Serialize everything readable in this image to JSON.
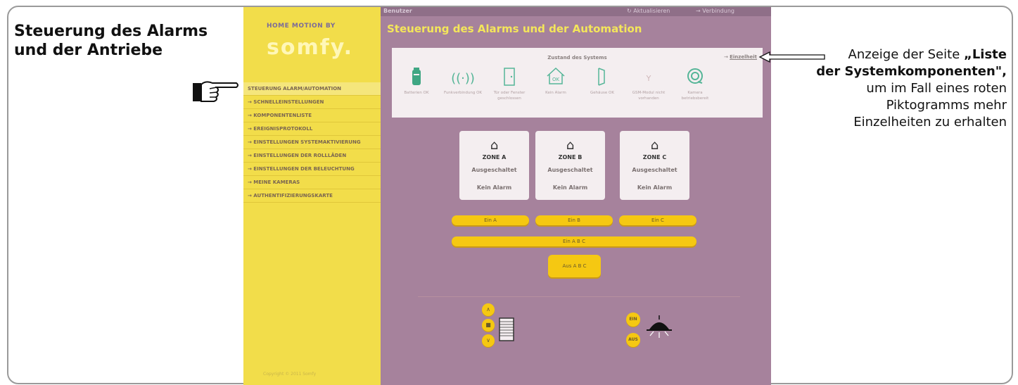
{
  "doc": {
    "title_line1": "Steuerung des Alarms",
    "title_line2": "und der Antriebe",
    "callout_line1": "Anzeige der Seite ",
    "callout_bold1": "„Liste",
    "callout_bold2": "der Systemkomponenten\",",
    "callout_line3": "um im Fall eines roten",
    "callout_line4": "Piktogramms mehr",
    "callout_line5": "Einzelheiten zu erhalten"
  },
  "app": {
    "topbar": {
      "user": "Benutzer",
      "refresh": "↻ Aktualisieren",
      "connection": "→ Verbindung"
    },
    "logo_small": "HOME MOTION BY",
    "logo_big": "somfy.",
    "menu": [
      "STEUERUNG ALARM/AUTOMATION",
      "→ SCHNELLEINSTELLUNGEN",
      "→ KOMPONENTENLISTE",
      "→ EREIGNISPROTOKOLL",
      "→ EINSTELLUNGEN SYSTEMAKTIVIERUNG",
      "→ EINSTELLUNGEN DER ROLLLÄDEN",
      "→ EINSTELLUNGEN DER BELEUCHTUNG",
      "→ MEINE KAMERAS",
      "→ AUTHENTIFIZIERUNGSKARTE"
    ],
    "copyright": "Copyright © 2011 Somfy",
    "page_title": "Steuerung des Alarms und der Automation",
    "status": {
      "title": "Zustand des Systems",
      "detail_arrow": "→",
      "detail_link": "Einzelheit",
      "items": [
        {
          "icon": "battery-icon",
          "label": "Batterien OK"
        },
        {
          "icon": "radio-icon",
          "label": "Funkverbindung OK"
        },
        {
          "icon": "door-icon",
          "label": "Tür oder Fenster geschlossen"
        },
        {
          "icon": "house-ok-icon",
          "label": "Kein Alarm"
        },
        {
          "icon": "housing-icon",
          "label": "Gehäuse OK"
        },
        {
          "icon": "gsm-icon",
          "label": "GSM-Modul nicht vorhanden"
        },
        {
          "icon": "camera-icon",
          "label": "Kamera betriebsbereit"
        }
      ]
    },
    "zones": [
      {
        "name": "ZONE A",
        "state": "Ausgeschaltet",
        "alarm": "Kein Alarm"
      },
      {
        "name": "ZONE B",
        "state": "Ausgeschaltet",
        "alarm": "Kein Alarm"
      },
      {
        "name": "ZONE C",
        "state": "Ausgeschaltet",
        "alarm": "Kein Alarm"
      }
    ],
    "buttons": {
      "ein_a": "Ein A",
      "ein_b": "Ein B",
      "ein_c": "Ein C",
      "ein_abc": "Ein A B C",
      "aus_abc": "Aus A B C"
    },
    "shutter": {
      "up": "∧",
      "stop": "■",
      "down": "∨"
    },
    "light": {
      "on": "EIN",
      "off": "AUS"
    }
  }
}
